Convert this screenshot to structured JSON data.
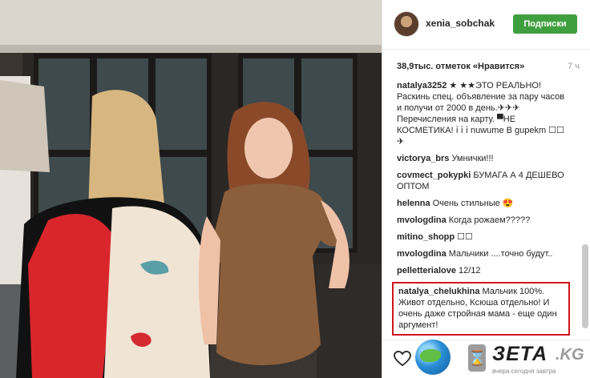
{
  "post": {
    "photo_alt": "",
    "username": "xenia_sobchak",
    "follow_label": "Подписки",
    "likes_text": "38,9тыс. отметок «Нравится»",
    "time_text": "7 ч"
  },
  "comments": [
    {
      "author": "natalya3252",
      "text": "★ ★★ЭТО РЕАЛЬНО! Раскинь спец. объявление за пару часов и получи от 2000 в день.✈✈✈ Перечисления на карту. ▀НЕ КОСМЕТИКА! ⅰ ⅰ ⅰ nuwume B gupekm ☐☐✈"
    },
    {
      "author": "victorya_brs",
      "text": "Умнички!!!"
    },
    {
      "author": "covmect_pokypki",
      "text": "БУМАГА А 4 ДЕШЕВО ОПТОМ"
    },
    {
      "author": "helenna",
      "text": "Очень стильные 😍"
    },
    {
      "author": "mvologdina",
      "text": "Когда рожаем?????"
    },
    {
      "author": "mitino_shopp",
      "text": "☐☐"
    },
    {
      "author": "mvologdina",
      "text": "Мальчики ....точно будут.."
    },
    {
      "author": "pelletterialove",
      "text": "12/12"
    },
    {
      "author": "natalya_chelukhina",
      "text": "Мальчик 100%. Живот отдельно, Ксюша отдельно! И очень даже стройная мама - еще один аргумент!"
    }
  ],
  "watermark": {
    "brand": "ЗЕТА",
    "tld": ".KG",
    "tagline": "вчера сегодня завтра"
  },
  "colors": {
    "follow_button": "#3f9f3f",
    "highlight_border": "#d0141b"
  },
  "icons": [
    "heart-icon",
    "globe-icon",
    "hourglass-icon"
  ]
}
